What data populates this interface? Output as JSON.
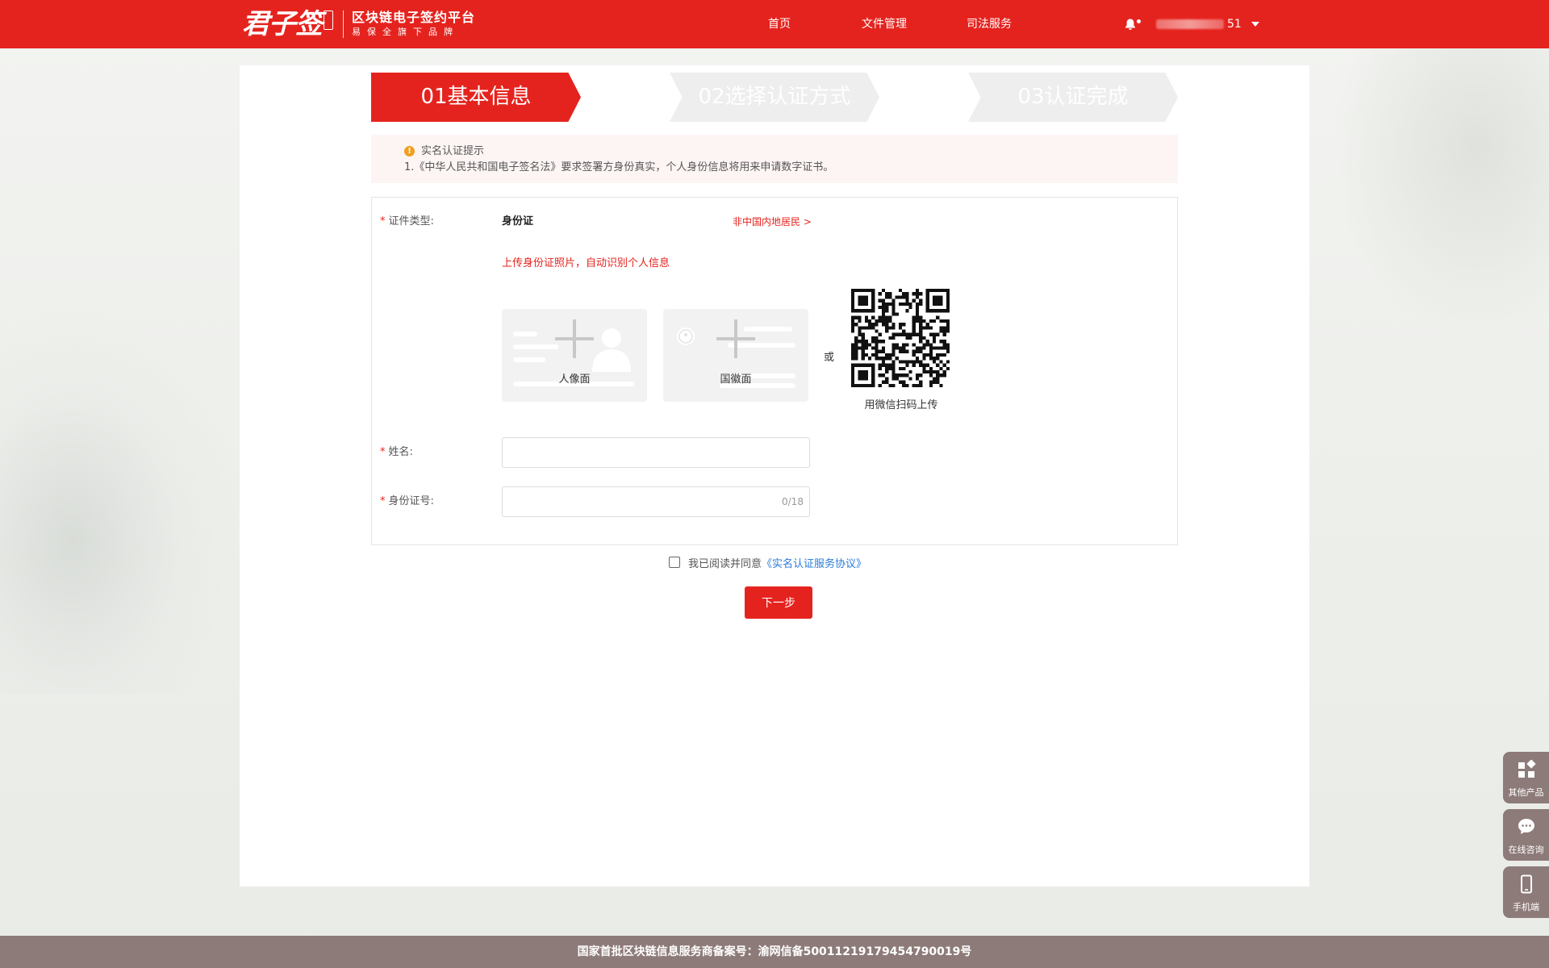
{
  "header": {
    "logo_main": "君子签",
    "logo_title": "区块链电子签约平台",
    "logo_sub": "易保全旗下品牌",
    "nav": [
      "首页",
      "文件管理",
      "司法服务"
    ],
    "user_suffix": "51"
  },
  "steps": [
    {
      "label": "01基本信息",
      "state": "active"
    },
    {
      "label": "02选择认证方式",
      "state": "inactive"
    },
    {
      "label": "03认证完成",
      "state": "inactive"
    }
  ],
  "notice": {
    "title": "实名认证提示",
    "text": "1.《中华人民共和国电子签名法》要求签署方身份真实，个人身份信息将用来申请数字证书。"
  },
  "form": {
    "id_type_label": "证件类型:",
    "id_type_value": "身份证",
    "foreign_link": "非中国内地居民 >",
    "upload_hint": "上传身份证照片，自动识别个人信息",
    "card_front_label": "人像面",
    "card_back_label": "国徽面",
    "or_text": "或",
    "qr_caption": "用微信扫码上传",
    "name_label": "姓名:",
    "name_value": "",
    "id_number_label": "身份证号:",
    "id_number_value": "",
    "id_number_counter": "0/18"
  },
  "agreement": {
    "text": "我已阅读并同意",
    "link": "《实名认证服务协议》",
    "checked": false
  },
  "next_button": "下一步",
  "side_widgets": [
    "其他产品",
    "在线咨询",
    "手机端"
  ],
  "footer": "国家首批区块链信息服务商备案号：渝网信备50011219179454790019号",
  "colors": {
    "brand_red": "#e5231e",
    "footer_bg": "#8d7b79",
    "link_blue": "#2b7bd9"
  }
}
